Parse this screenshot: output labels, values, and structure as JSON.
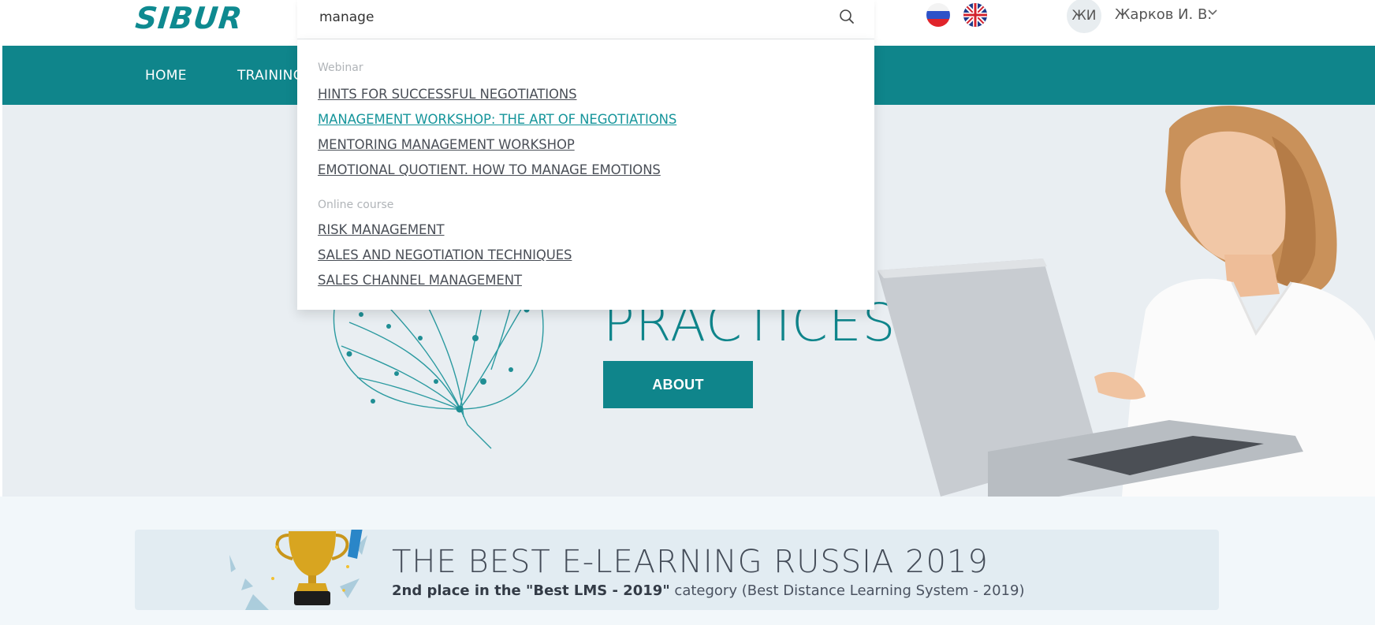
{
  "header": {
    "logo": "SIBUR",
    "user": {
      "initials": "ЖИ",
      "name": "Жарков И. В."
    },
    "languages": [
      "ru-flag-icon",
      "gb-flag-icon"
    ]
  },
  "nav": {
    "home": "HOME",
    "training": "TRAINING"
  },
  "search": {
    "value": "manage",
    "groups": [
      {
        "label": "Webinar",
        "items": [
          "HINTS FOR SUCCESSFUL NEGOTIATIONS",
          "MANAGEMENT WORKSHOP: THE ART OF NEGOTIATIONS",
          "MENTORING MANAGEMENT WORKSHOP",
          "EMOTIONAL QUOTIENT. HOW TO MANAGE EMOTIONS"
        ]
      },
      {
        "label": "Online course",
        "items": [
          "RISK MANAGEMENT",
          "SALES AND NEGOTIATION TECHNIQUES",
          "SALES CHANNEL MANAGEMENT"
        ]
      }
    ],
    "active_item": "MANAGEMENT WORKSHOP: THE ART OF NEGOTIATIONS"
  },
  "hero": {
    "title_visible": "PRACTICES",
    "button": "ABOUT"
  },
  "award": {
    "title": "THE BEST E-LEARNING RUSSIA 2019",
    "subtitle_bold": "2nd place in the \"Best LMS - 2019\"",
    "subtitle_rest": " category (Best Distance Learning System - 2019)"
  },
  "colors": {
    "brand": "#0f858b",
    "link_active": "#16959b",
    "hero_bg": "#e9eef2"
  }
}
